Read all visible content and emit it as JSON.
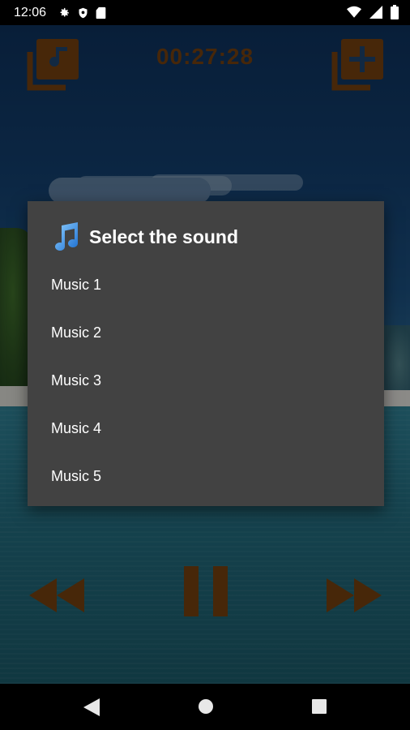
{
  "status_bar": {
    "time": "12:06",
    "left_icons": [
      "gear-icon",
      "shield-icon",
      "sd-card-icon"
    ],
    "right_icons": [
      "wifi-icon",
      "signal-icon",
      "battery-icon"
    ]
  },
  "top_bar": {
    "timer": "00:27:28",
    "left_button_icon": "music-library-icon",
    "right_button_icon": "add-library-icon"
  },
  "dialog": {
    "icon": "music-note-icon",
    "title": "Select the sound",
    "items": [
      {
        "label": "Music 1"
      },
      {
        "label": "Music 2"
      },
      {
        "label": "Music 3"
      },
      {
        "label": "Music 4"
      },
      {
        "label": "Music 5"
      }
    ]
  },
  "controls": {
    "prev_icon": "rewind-icon",
    "pause_icon": "pause-icon",
    "next_icon": "fast-forward-icon"
  },
  "nav_bar": {
    "back_icon": "back-triangle-icon",
    "home_icon": "home-circle-icon",
    "recents_icon": "recents-square-icon"
  },
  "colors": {
    "accent": "#6e3d0f",
    "dialog_bg": "#424242",
    "dialog_text": "#ffffff"
  }
}
